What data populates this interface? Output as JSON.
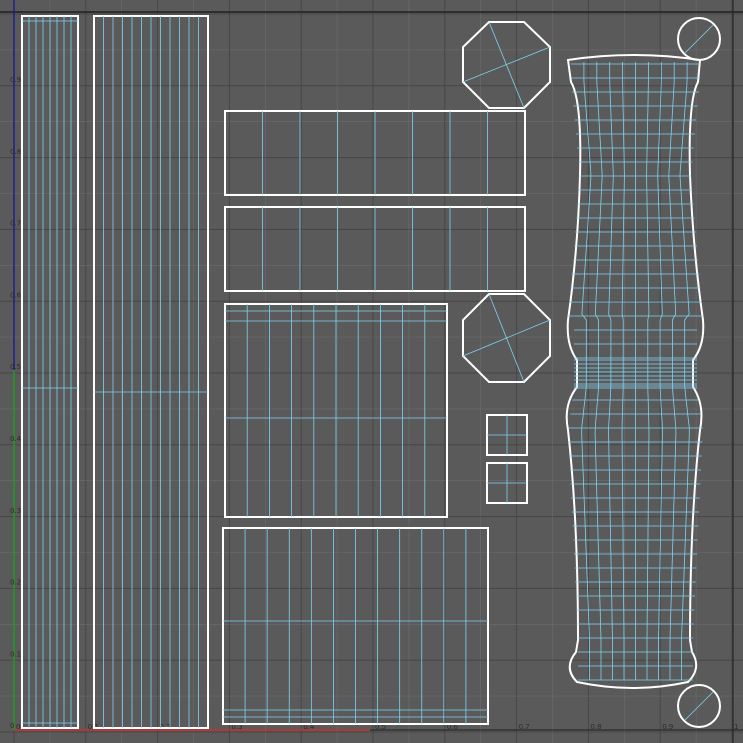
{
  "app": {
    "view": "UV Texture Editor"
  },
  "colors": {
    "background": "#5a5a5a",
    "grid_line": "#6c6c6c",
    "grid_major": "#464646",
    "border_line": "#1f1f1f",
    "shell_outline": "#ffffff",
    "wire": "#7fd3f0",
    "axis_u": "#c8302a",
    "axis_v": "#1aa01a",
    "axis_frame": "#1e1e8e"
  },
  "axis": {
    "u_ticks": [
      "0",
      "0.1",
      "0.2",
      "0.3",
      "0.4",
      "0.5",
      "0.6",
      "0.7",
      "0.8",
      "0.9",
      "1"
    ],
    "v_ticks": [
      "0.9",
      "0.8",
      "0.7",
      "0.6",
      "0.5",
      "0.4",
      "0.3",
      "0.2",
      "0.1",
      "0"
    ]
  },
  "uv_shells": [
    "left-thin-strip",
    "left-wide-strip",
    "top-rect-1",
    "top-rect-2",
    "middle-square",
    "bottom-rect",
    "octagon-top",
    "octagon-middle",
    "small-square-1",
    "small-square-2",
    "column-body",
    "circle-top",
    "circle-bottom"
  ]
}
